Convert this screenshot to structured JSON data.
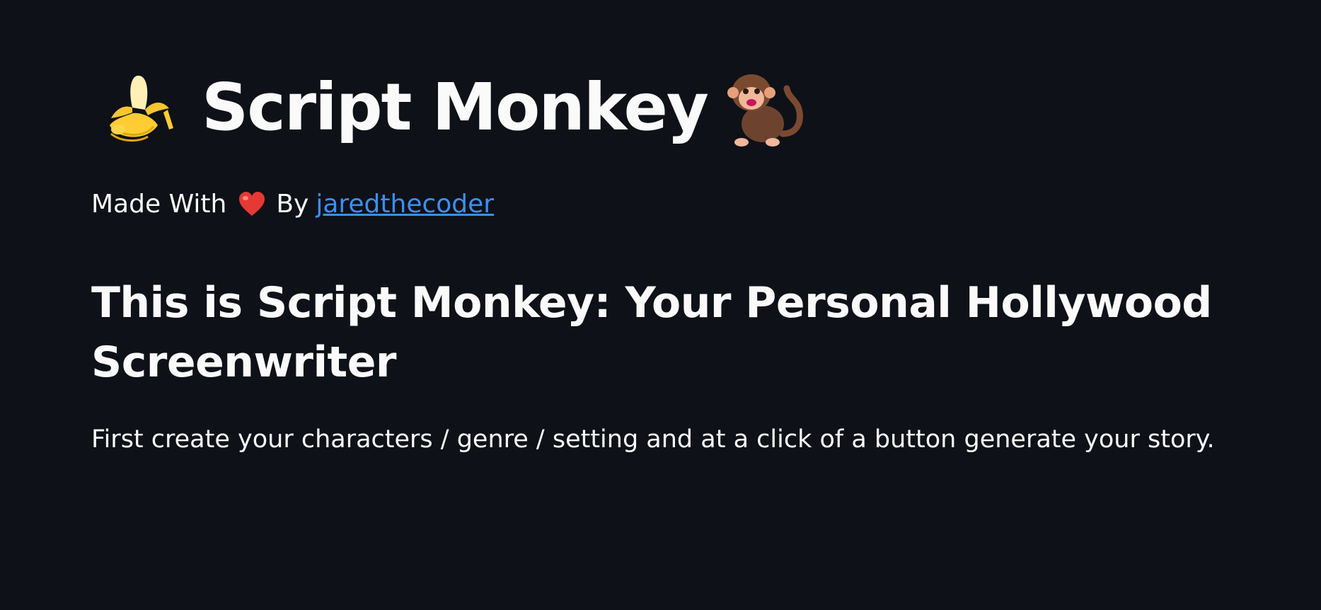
{
  "header": {
    "title": "Script Monkey",
    "left_icon": "banana-icon",
    "right_icon": "monkey-icon"
  },
  "byline": {
    "made_with": "Made With",
    "heart_icon": "heart-icon",
    "by": "By",
    "author_link": "jaredthecoder"
  },
  "main": {
    "headline": "This is Script Monkey: Your Personal Hollywood Screenwriter",
    "description": "First create your characters / genre / setting and at a click of a button generate your story."
  },
  "colors": {
    "background": "#0e1117",
    "text": "#fafafa",
    "link": "#3b8ff5"
  }
}
